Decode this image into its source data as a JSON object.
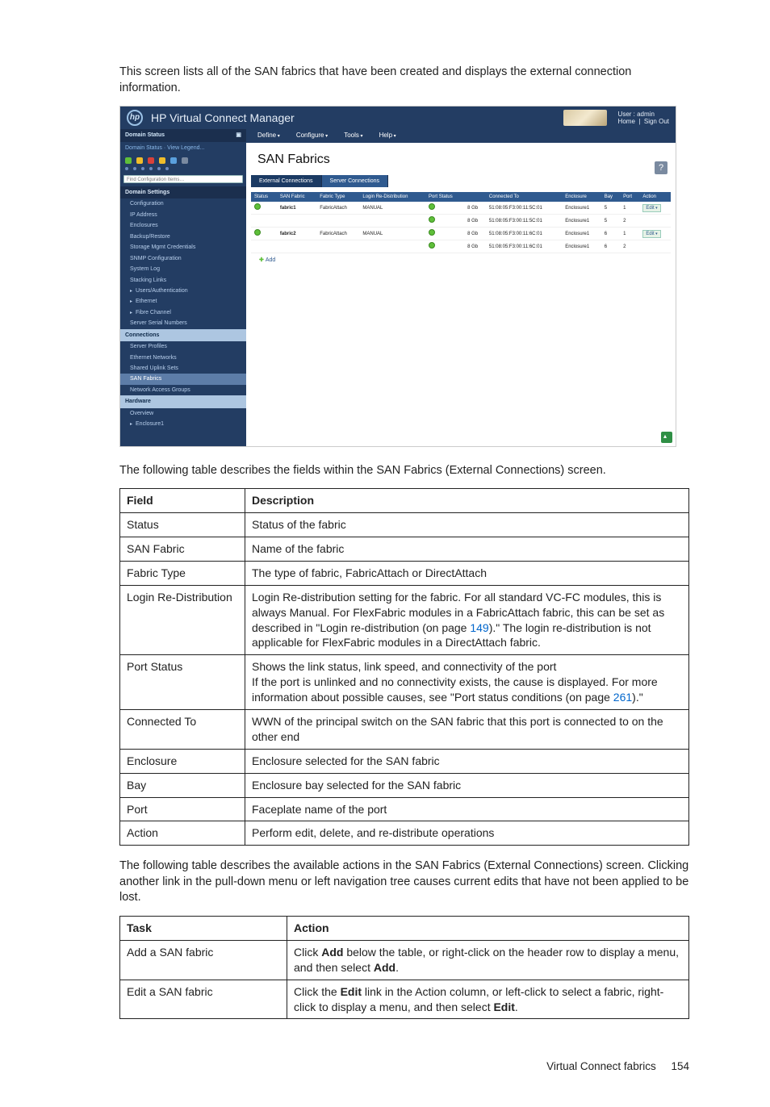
{
  "intro": "This screen lists all of the SAN fabrics that have been created and displays the external connection information.",
  "app": {
    "title": "HP Virtual Connect Manager",
    "user_label": "User : admin",
    "home": "Home",
    "signout": "Sign Out",
    "sidebar": {
      "domain_status": "Domain Status",
      "status_legend": "Domain Status · View Legend...",
      "find_placeholder": "Find Configuration Items…",
      "sections": {
        "domain_settings": "Domain Settings",
        "connections": "Connections",
        "hardware": "Hardware"
      },
      "items": {
        "configuration": "Configuration",
        "ip_address": "IP Address",
        "enclosures": "Enclosures",
        "backup_restore": "Backup/Restore",
        "storage_creds": "Storage Mgmt Credentials",
        "snmp": "SNMP Configuration",
        "system_log": "System Log",
        "stacking": "Stacking Links",
        "users_auth": "Users/Authentication",
        "ethernet": "Ethernet",
        "fibre": "Fibre Channel",
        "serial": "Server Serial Numbers",
        "server_profiles": "Server Profiles",
        "ethernet_networks": "Ethernet Networks",
        "shared_uplink": "Shared Uplink Sets",
        "san_fabrics": "SAN Fabrics",
        "network_access": "Network Access Groups",
        "overview": "Overview",
        "enclosure1": "Enclosure1"
      }
    },
    "menus": {
      "define": "Define",
      "configure": "Configure",
      "tools": "Tools",
      "help": "Help"
    },
    "page_title": "SAN Fabrics",
    "tabs": {
      "external": "External Connections",
      "server": "Server Connections"
    },
    "table": {
      "headers": {
        "status": "Status",
        "san": "SAN Fabric",
        "type": "Fabric Type",
        "login": "Login Re-Distribution",
        "pstatus": "Port Status",
        "gb": "",
        "connected": "Connected To",
        "enclosure": "Enclosure",
        "bay": "Bay",
        "port": "Port",
        "action": "Action"
      },
      "rows": [
        {
          "san": "fabric1",
          "type": "FabricAttach",
          "login": "MANUAL",
          "ports": [
            {
              "gb": "8 Gb",
              "wwn": "51:08:05:F3:00:11:5C:01",
              "encl": "Enclosure1",
              "bay": "5",
              "port": "1"
            },
            {
              "gb": "8 Gb",
              "wwn": "51:08:05:F3:00:11:5C:01",
              "encl": "Enclosure1",
              "bay": "5",
              "port": "2"
            }
          ],
          "edit": "Edit"
        },
        {
          "san": "fabric2",
          "type": "FabricAttach",
          "login": "MANUAL",
          "ports": [
            {
              "gb": "8 Gb",
              "wwn": "51:08:05:F3:00:11:6C:01",
              "encl": "Enclosure1",
              "bay": "6",
              "port": "1"
            },
            {
              "gb": "8 Gb",
              "wwn": "51:08:05:F3:00:11:6C:01",
              "encl": "Enclosure1",
              "bay": "6",
              "port": "2"
            }
          ],
          "edit": "Edit"
        }
      ],
      "add": "Add"
    }
  },
  "fields_intro": "The following table describes the fields within the SAN Fabrics (External Connections) screen.",
  "fields_table": {
    "h1": "Field",
    "h2": "Description",
    "rows": [
      {
        "f": "Status",
        "d": "Status of the fabric"
      },
      {
        "f": "SAN Fabric",
        "d": "Name of the fabric"
      },
      {
        "f": "Fabric Type",
        "d": "The type of fabric, FabricAttach or DirectAttach"
      },
      {
        "f": "Login Re-Distribution",
        "d_html": "Login Re-distribution setting for the fabric. For all standard VC-FC modules, this is always Manual. For FlexFabric modules in a FabricAttach fabric, this can be set as described in \"Login re-distribution (on page <span class='link'>149</span>).\" The login re-distribution is not applicable for FlexFabric modules in a DirectAttach fabric."
      },
      {
        "f": "Port Status",
        "d_html": "Shows the link status, link speed, and connectivity of the port<br>If the port is unlinked and no connectivity exists, the cause is displayed. For more information about possible causes, see \"Port status conditions (on page <span class='link'>261</span>).\""
      },
      {
        "f": "Connected To",
        "d": "WWN of the principal switch on the SAN fabric that this port is connected to on the other end"
      },
      {
        "f": "Enclosure",
        "d": "Enclosure selected for the SAN fabric"
      },
      {
        "f": "Bay",
        "d": "Enclosure bay selected for the SAN fabric"
      },
      {
        "f": "Port",
        "d": "Faceplate name of the port"
      },
      {
        "f": "Action",
        "d": "Perform edit, delete, and re-distribute operations"
      }
    ]
  },
  "actions_intro": "The following table describes the available actions in the SAN Fabrics (External Connections) screen. Clicking another link in the pull-down menu or left navigation tree causes current edits that have not been applied to be lost.",
  "actions_table": {
    "h1": "Task",
    "h2": "Action",
    "rows": [
      {
        "t": "Add a SAN fabric",
        "a_html": "Click <b>Add</b> below the table, or right-click on the header row to display a menu, and then select <b>Add</b>."
      },
      {
        "t": "Edit a SAN fabric",
        "a_html": "Click the <b>Edit</b> link in the Action column, or left-click to select a fabric, right-click to display a menu, and then select <b>Edit</b>."
      }
    ]
  },
  "footer": {
    "label": "Virtual Connect fabrics",
    "page": "154"
  }
}
